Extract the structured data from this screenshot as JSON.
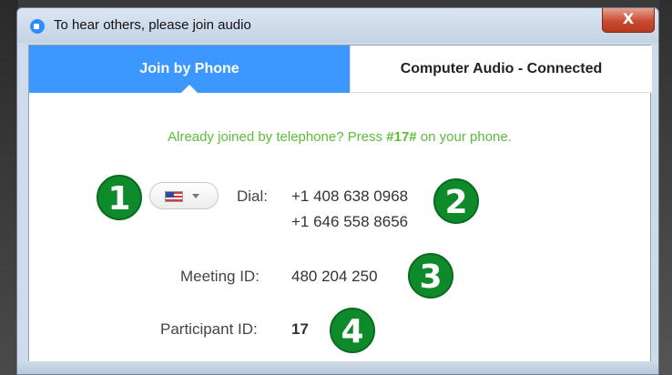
{
  "window": {
    "title": "To hear others, please join audio",
    "close_label": "X"
  },
  "tabs": [
    {
      "label": "Join by Phone",
      "active": true
    },
    {
      "label": "Computer Audio - Connected",
      "active": false
    }
  ],
  "notice": {
    "prefix": "Already joined by telephone? Press ",
    "code": "#17#",
    "suffix": " on your phone."
  },
  "dial": {
    "label": "Dial:",
    "numbers": [
      "+1 408 638 0968",
      "+1 646 558 8656"
    ],
    "country_icon": "us-flag-icon"
  },
  "meeting": {
    "label": "Meeting ID:",
    "value": "480 204 250"
  },
  "participant": {
    "label": "Participant ID:",
    "value": "17"
  },
  "callouts": [
    "1",
    "2",
    "3",
    "4"
  ],
  "colors": {
    "accent": "#3c97ff",
    "notice": "#5bbd3a",
    "callout": "#0e8a2a"
  }
}
